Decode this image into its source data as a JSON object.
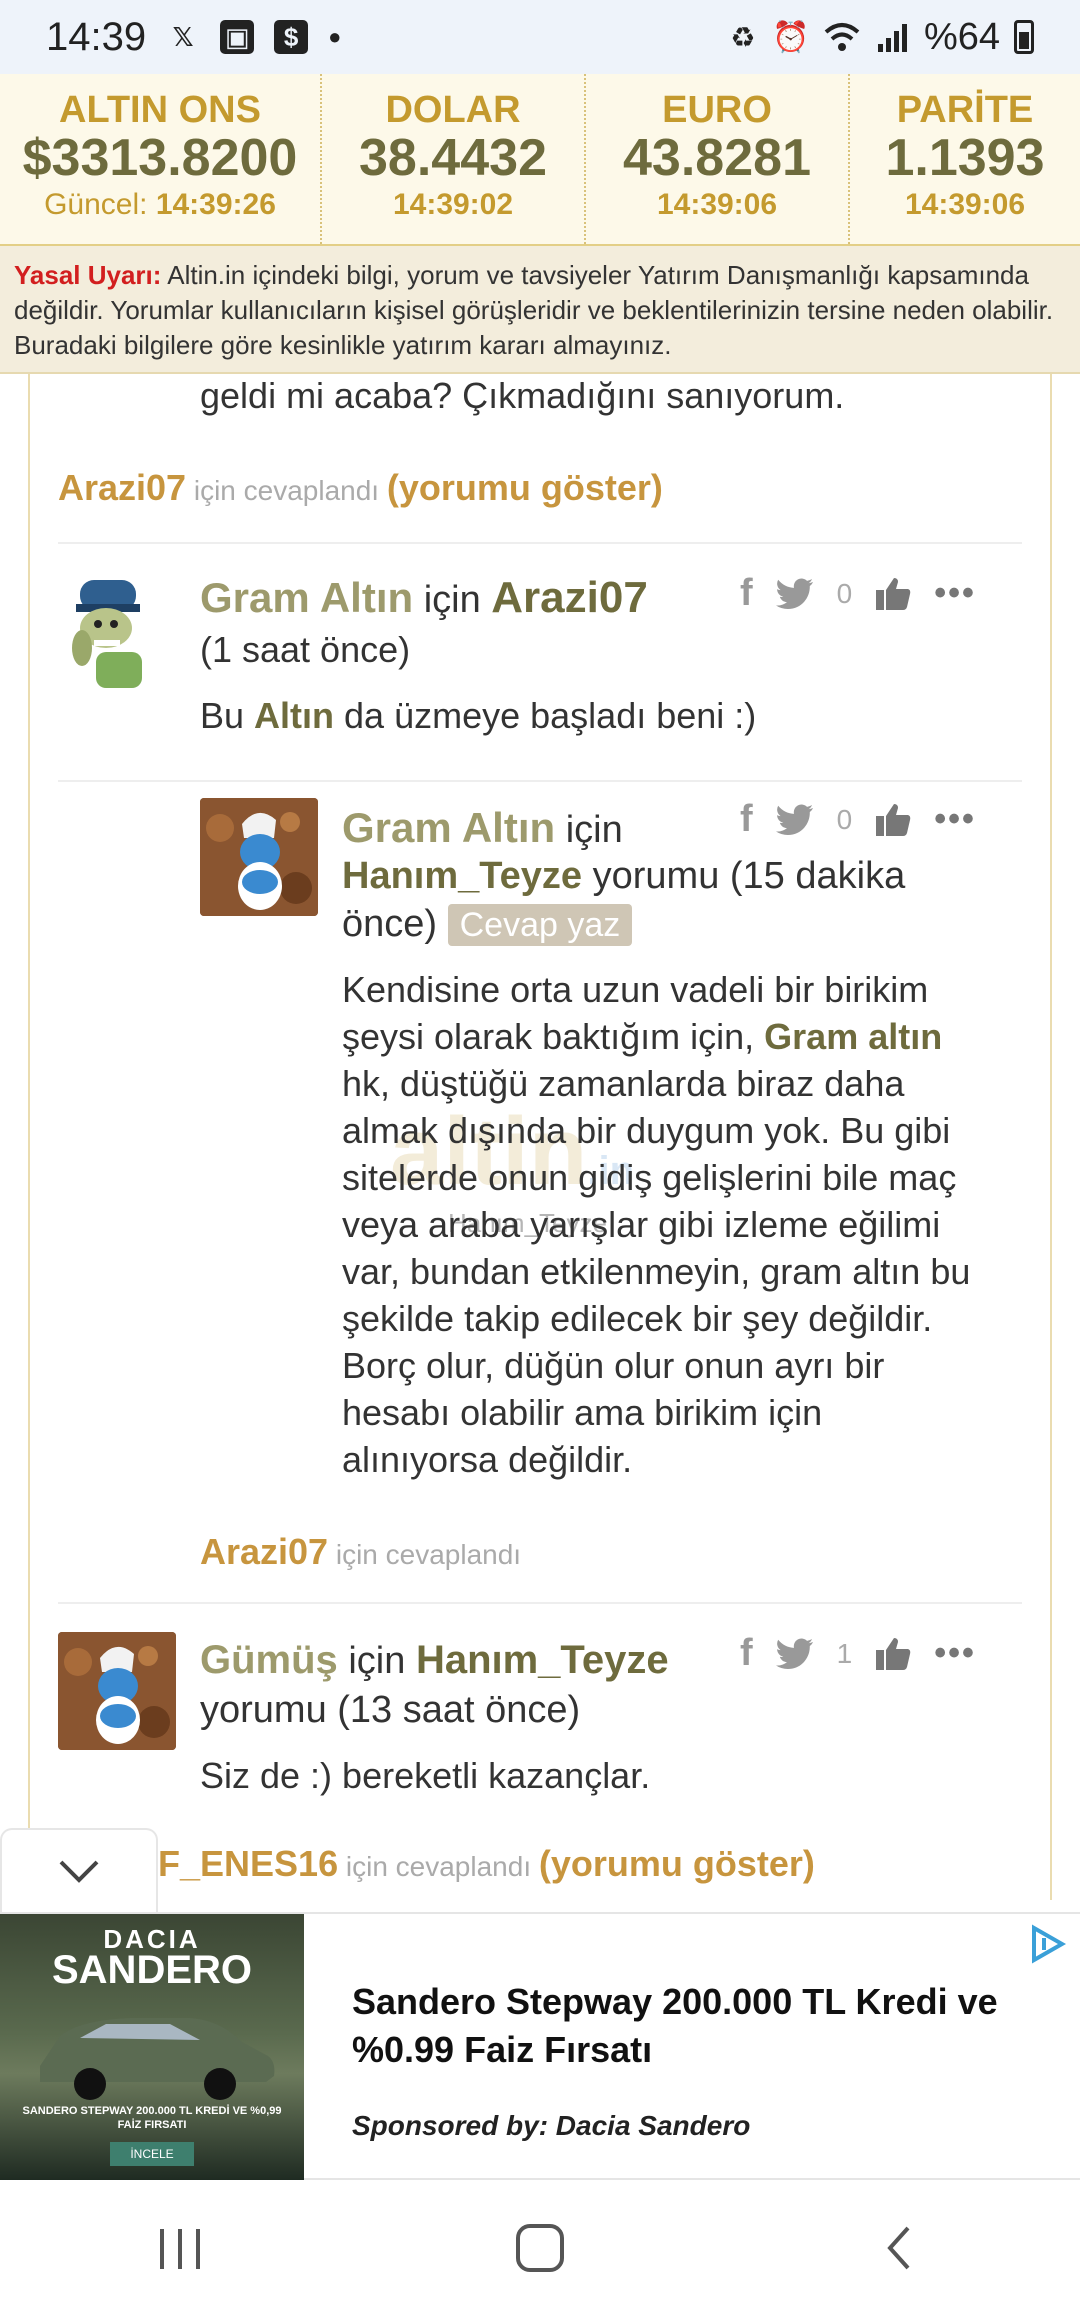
{
  "status_bar": {
    "time": "14:39",
    "battery": "%64",
    "icons": [
      "x-icon",
      "gallery-icon",
      "dollar-app-icon",
      "dot-icon",
      "recycle-icon",
      "alarm-icon",
      "wifi-icon",
      "signal-icon",
      "battery-icon"
    ]
  },
  "ticker": [
    {
      "label": "ALTIN ONS",
      "value": "$3313.8200",
      "time_prefix": "Güncel: ",
      "time": "14:39:26"
    },
    {
      "label": "DOLAR",
      "value": "38.4432",
      "time_prefix": "",
      "time": "14:39:02"
    },
    {
      "label": "EURO",
      "value": "43.8281",
      "time_prefix": "",
      "time": "14:39:06"
    },
    {
      "label": "PARİTE",
      "value": "1.1393",
      "time_prefix": "",
      "time": "14:39:06"
    }
  ],
  "warning": {
    "label": "Yasal Uyarı:",
    "text": " Altin.in içindeki bilgi, yorum ve tavsiyeler Yatırım Danışmanlığı kapsamında değildir. Yorumlar kullanıcıların kişisel görüşleridir ve beklentilerinizin tersine neden olabilir. Buradaki bilgilere göre kesinlikle yatırım kararı almayınız."
  },
  "partial_comment": {
    "text": "geldi mi acaba? Çıkmadığını sanıyorum.",
    "reply_user": "Arazi07",
    "reply_suffix": " için cevaplandı ",
    "show_link": "(yorumu göster)"
  },
  "comments": [
    {
      "category": "Gram Altın",
      "for_word": " için ",
      "target": "Arazi07",
      "meta": "(1 saat önce)",
      "body_pre": "Bu ",
      "body_highlight": "Altın",
      "body_post": " da üzmeye başladı beni :)",
      "likes": "0"
    },
    {
      "category": "Gram Altın",
      "for_word": " için",
      "target": "Hanım_Teyze",
      "meta_suffix": " yorumu (15 dakika",
      "meta_line2": "önce)",
      "reply_button": "Cevap yaz",
      "body_line1": "Kendisine orta uzun vadeli bir birikim",
      "body_line2_pre": "şeysi olarak baktığım için, ",
      "body_line2_highlight": "Gram altın",
      "body_lines": [
        "hk, düştüğü zamanlarda biraz daha",
        "almak dışında bir duygum yok. Bu gibi",
        "sitelerde onun gidiş gelişlerini bile maç",
        "veya araba yarışlar gibi izleme eğilimi",
        "var, bundan etkilenmeyin, gram altın bu",
        "şekilde takip edilecek bir şey değildir.",
        "Borç olur, düğün olur onun ayrı bir",
        "hesabı olabilir ama birikim için",
        "alınıyorsa değildir."
      ],
      "watermark_brand": "altin",
      "watermark_tld": ".in",
      "watermark_user": "Hanım_Teyze",
      "likes": "0",
      "reply_user": "Arazi07",
      "reply_suffix": " için cevaplandı"
    },
    {
      "category": "Gümüş",
      "for_word": " için ",
      "target": "Hanım_Teyze",
      "meta": "yorumu (13 saat önce)",
      "body": "Siz de :) bereketli kazançlar.",
      "likes": "1",
      "reply_user": "F_ENES16",
      "reply_suffix": " için cevaplandı ",
      "show_link": "(yorumu göster)"
    }
  ],
  "ad": {
    "brand_top": "DACIA",
    "brand_model": "SANDERO",
    "img_caption": "SANDERO STEPWAY 200.000 TL KREDİ VE %0,99 FAİZ FIRSATI",
    "img_button": "İNCELE",
    "title": "Sandero Stepway 200.000 TL Kredi ve %0.99 Faiz Fırsatı",
    "sponsor": "Sponsored by: Dacia Sandero"
  }
}
